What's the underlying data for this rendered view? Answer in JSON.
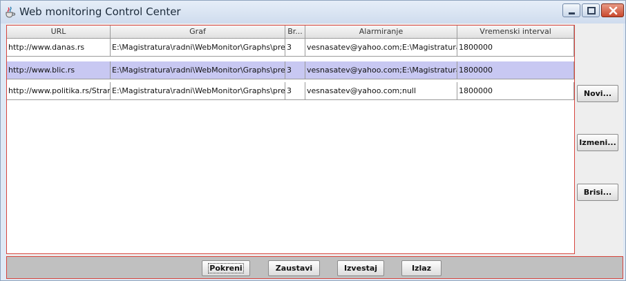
{
  "window": {
    "title": "Web monitoring Control Center"
  },
  "table": {
    "columns": [
      "URL",
      "Graf",
      "Br...",
      "Alarmiranje",
      "Vremenski interval"
    ],
    "rows": [
      [
        "http://www.danas.rs",
        "E:\\Magistratura\\radni\\WebMonitor\\Graphs\\pred...",
        "3",
        "vesnasatev@yahoo.com;E:\\Magistratura...",
        "1800000"
      ],
      [
        "http://www.blic.rs",
        "E:\\Magistratura\\radni\\WebMonitor\\Graphs\\pred...",
        "3",
        "vesnasatev@yahoo.com;E:\\Magistratura...",
        "1800000"
      ],
      [
        "http://www.politika.rs/Stran...",
        "E:\\Magistratura\\radni\\WebMonitor\\Graphs\\pred...",
        "3",
        "vesnasatev@yahoo.com;null",
        "1800000"
      ]
    ],
    "selected_row": 1
  },
  "side_buttons": {
    "novi": "Novi...",
    "izmeni": "Izmeni...",
    "brisi": "Brisi..."
  },
  "bottom_buttons": {
    "pokreni": "Pokreni",
    "zaustavi": "Zaustavi",
    "izvestaj": "Izvestaj",
    "izlaz": "Izlaz"
  },
  "colors": {
    "selection": "#c8c8f2",
    "border_highlight": "#d6443c",
    "close_button": "#c9492e"
  },
  "icons": [
    "java-cup-icon",
    "minimize-icon",
    "maximize-icon",
    "close-icon"
  ]
}
